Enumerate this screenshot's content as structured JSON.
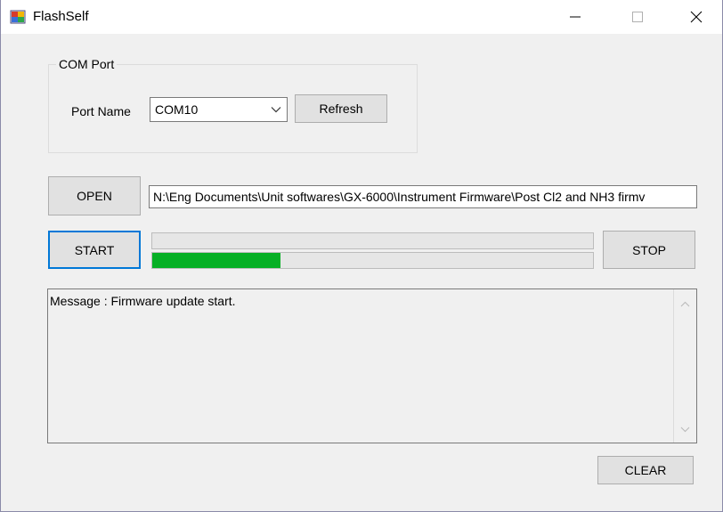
{
  "window": {
    "title": "FlashSelf",
    "icon": "application-icon",
    "controls": [
      "minimize-icon",
      "maximize-icon",
      "close-icon"
    ]
  },
  "com_port": {
    "group_label": "COM Port",
    "port_name_label": "Port Name",
    "port_name_value": "COM10",
    "refresh_label": "Refresh"
  },
  "file": {
    "open_label": "OPEN",
    "path": "N:\\Eng Documents\\Unit softwares\\GX-6000\\Instrument Firmware\\Post Cl2 and NH3 firmv"
  },
  "flash": {
    "start_label": "START",
    "stop_label": "STOP",
    "progress_top_fraction": 0,
    "progress_bottom_fraction": 0.29
  },
  "messages": {
    "text": "Message : Firmware update start.",
    "clear_label": "CLEAR"
  },
  "colors": {
    "progress_fill": "#06b025",
    "focus_border": "#0078d7"
  }
}
